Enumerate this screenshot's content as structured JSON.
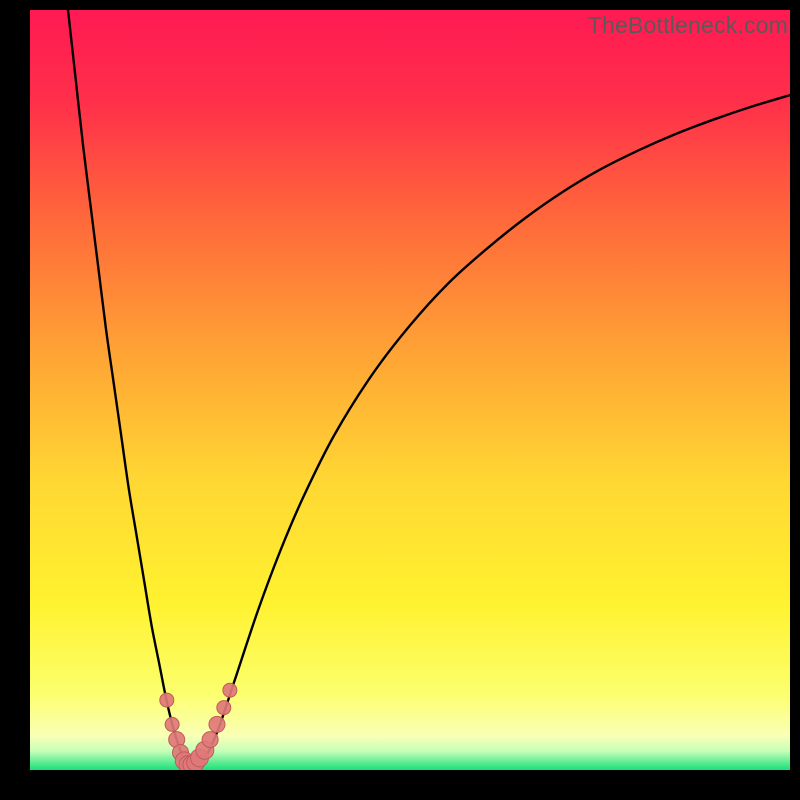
{
  "watermark": "TheBottleneck.com",
  "colors": {
    "frame": "#000000",
    "gradient_stops": [
      {
        "offset": 0.0,
        "color": "#ff1a53"
      },
      {
        "offset": 0.12,
        "color": "#ff2f4a"
      },
      {
        "offset": 0.28,
        "color": "#ff6a3a"
      },
      {
        "offset": 0.45,
        "color": "#ffa335"
      },
      {
        "offset": 0.62,
        "color": "#ffd733"
      },
      {
        "offset": 0.78,
        "color": "#fff22f"
      },
      {
        "offset": 0.9,
        "color": "#fcff6e"
      },
      {
        "offset": 0.955,
        "color": "#faffb6"
      },
      {
        "offset": 0.975,
        "color": "#c6ffb8"
      },
      {
        "offset": 1.0,
        "color": "#18e07a"
      }
    ],
    "curve": "#000000",
    "marker_fill": "#e07878",
    "marker_stroke": "#c05b5b"
  },
  "chart_data": {
    "type": "line",
    "title": "",
    "xlabel": "",
    "ylabel": "",
    "xlim": [
      0,
      100
    ],
    "ylim": [
      0,
      100
    ],
    "series": [
      {
        "name": "bottleneck-curve",
        "x": [
          5,
          6,
          7,
          8,
          9,
          10,
          11,
          12,
          13,
          14,
          15,
          16,
          17,
          18,
          19,
          20,
          20.5,
          21,
          22,
          23,
          24,
          25,
          27,
          30,
          33,
          36,
          40,
          45,
          50,
          55,
          60,
          65,
          70,
          75,
          80,
          85,
          90,
          95,
          100
        ],
        "y": [
          100,
          91,
          82,
          74,
          66,
          58,
          51,
          44,
          37,
          31,
          25,
          19,
          14,
          9,
          5,
          2,
          1,
          0.5,
          0.5,
          1.5,
          3.5,
          6,
          12,
          21,
          29,
          36,
          44,
          52,
          58.5,
          64,
          68.5,
          72.5,
          76,
          79,
          81.5,
          83.7,
          85.6,
          87.3,
          88.8
        ]
      }
    ],
    "markers": {
      "name": "data-points",
      "x": [
        18.0,
        18.7,
        19.3,
        19.8,
        20.3,
        20.8,
        21.3,
        21.8,
        22.3,
        23.0,
        23.7,
        24.6,
        25.5,
        26.3
      ],
      "y": [
        9.2,
        6.0,
        4.0,
        2.3,
        1.2,
        0.7,
        0.7,
        1.0,
        1.6,
        2.6,
        4.0,
        6.0,
        8.2,
        10.5
      ],
      "r": [
        7,
        7,
        8,
        8,
        9,
        9,
        9,
        9,
        9,
        9,
        8,
        8,
        7,
        7
      ]
    }
  }
}
